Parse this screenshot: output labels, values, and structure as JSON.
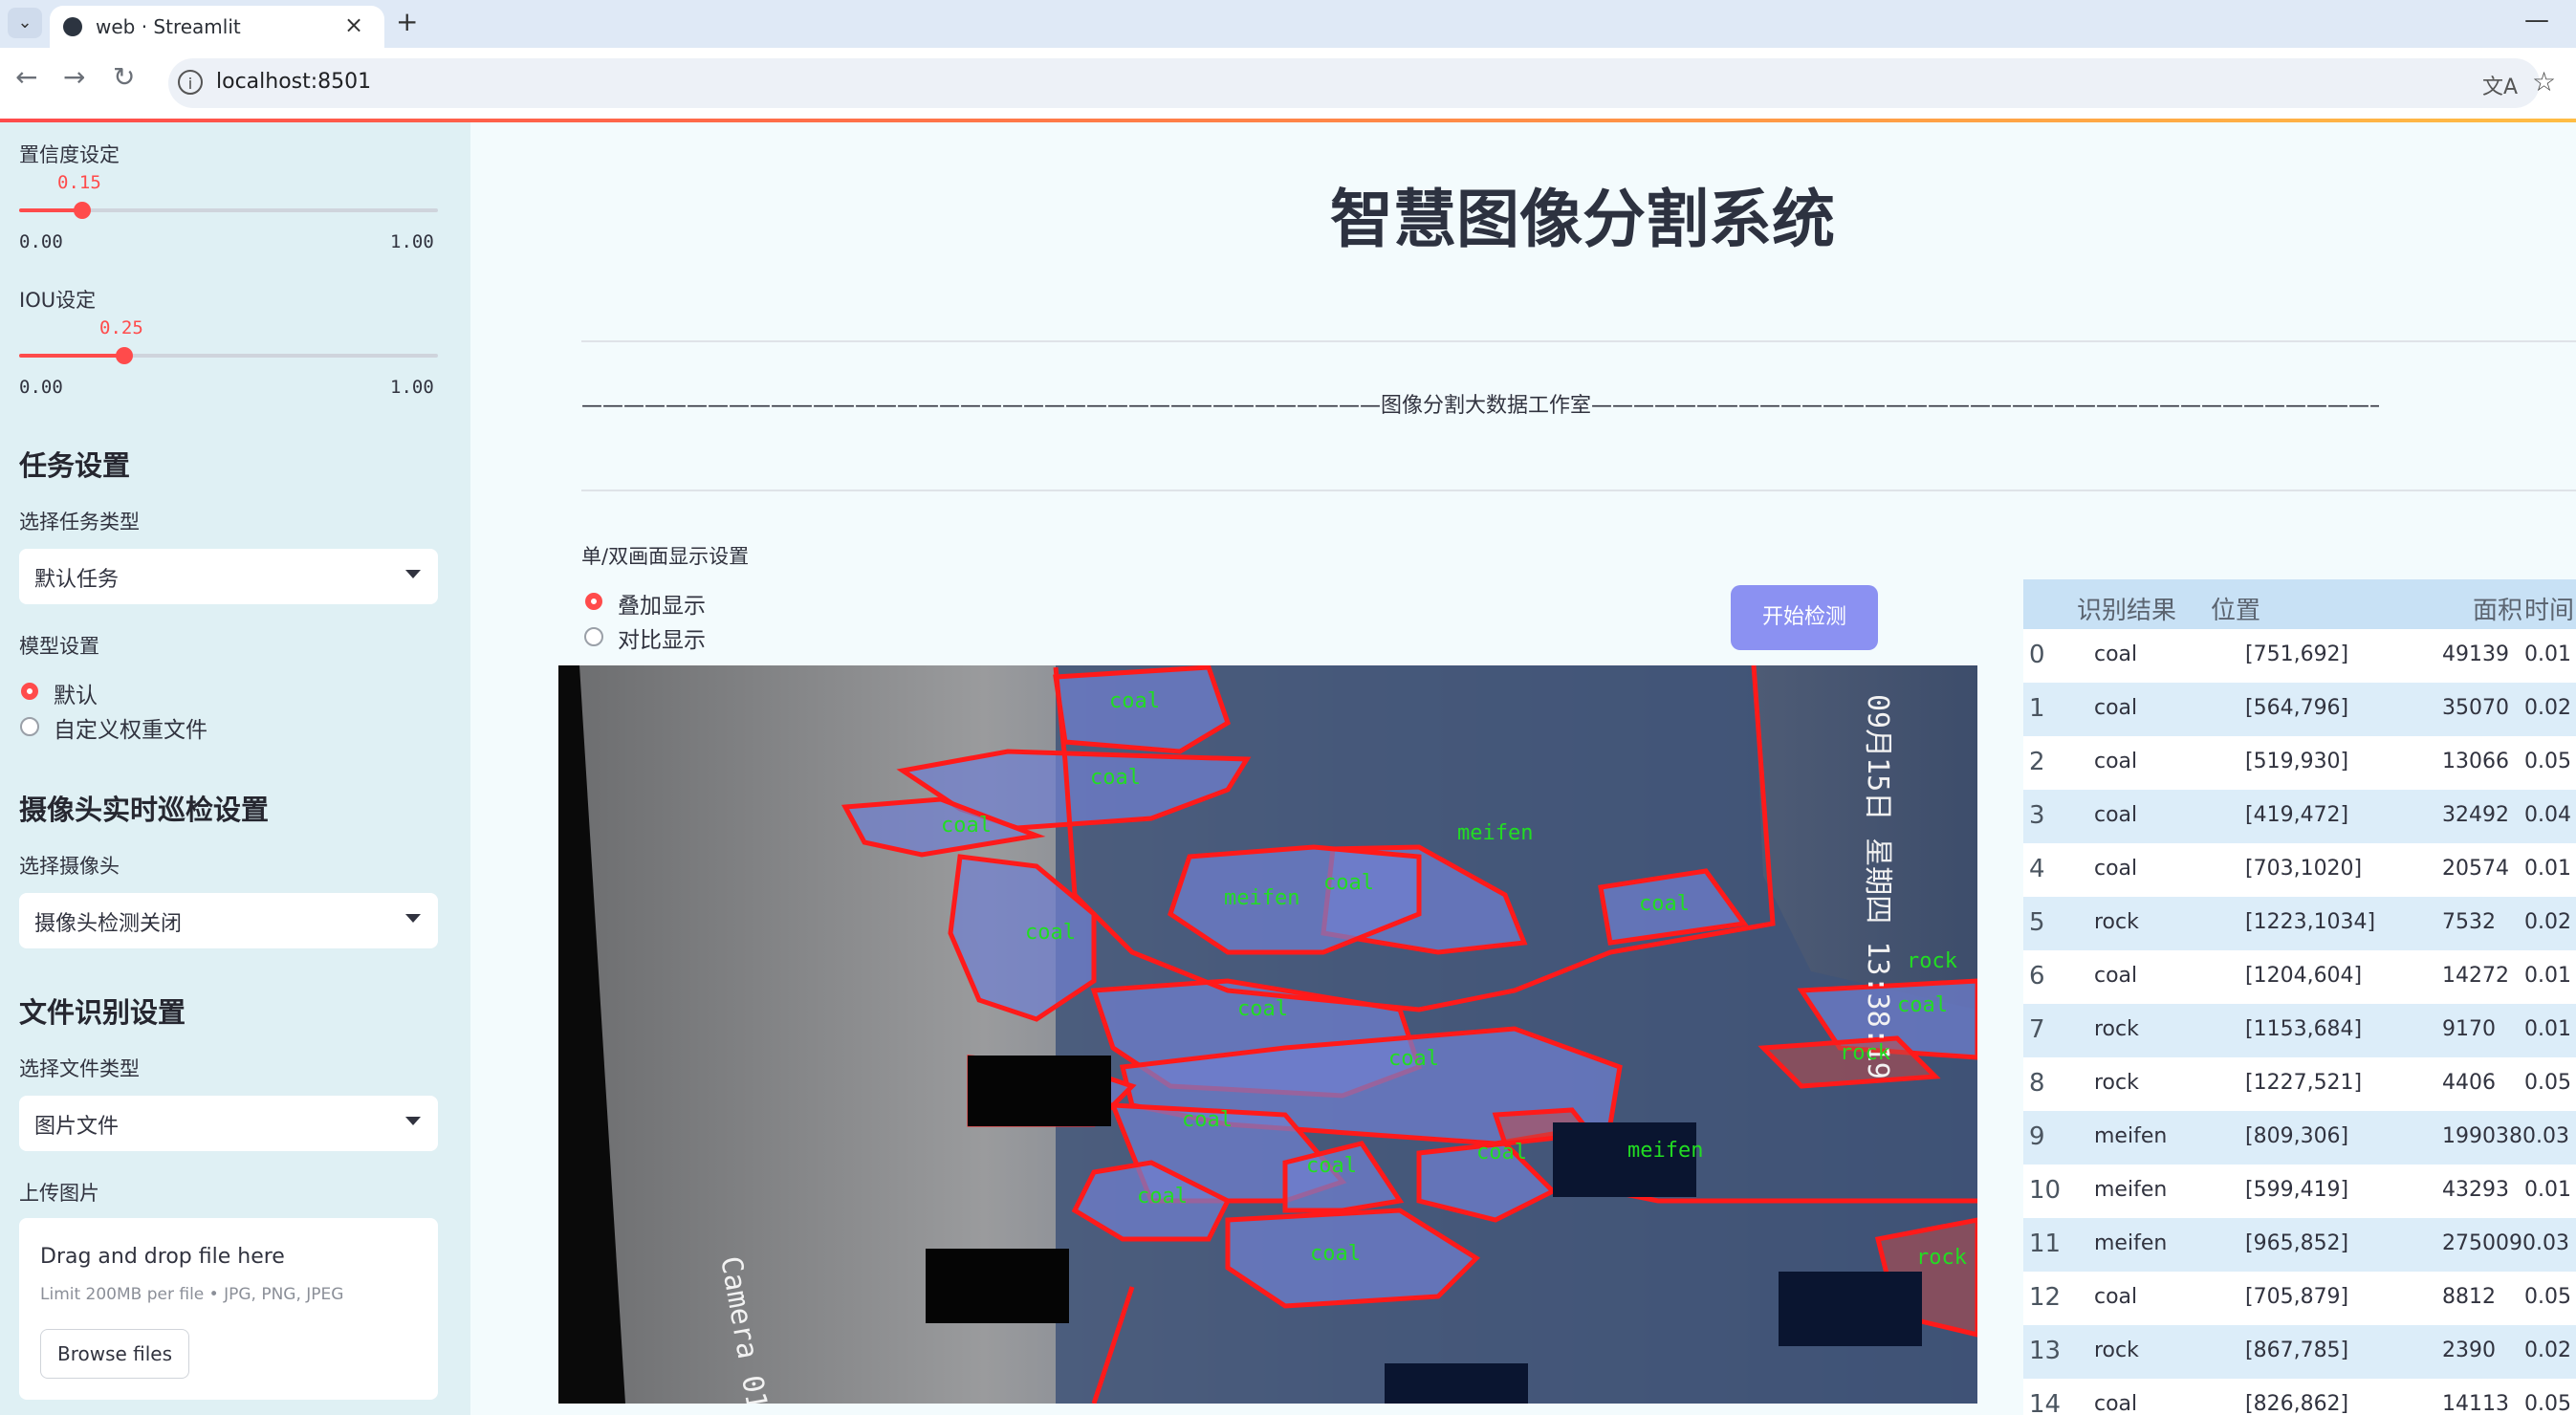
{
  "browser": {
    "tab_title": "web · Streamlit",
    "url": "localhost:8501",
    "tab_close": "×",
    "new_tab": "+",
    "minimize": "—"
  },
  "sidebar": {
    "confidence": {
      "label": "置信度设定",
      "value": "0.15",
      "value_fraction": 0.15,
      "min": "0.00",
      "max": "1.00"
    },
    "iou": {
      "label": "IOU设定",
      "value": "0.25",
      "value_fraction": 0.25,
      "min": "0.00",
      "max": "1.00"
    },
    "task_settings": {
      "heading": "任务设置",
      "select_label": "选择任务类型",
      "select_value": "默认任务"
    },
    "model_settings": {
      "label": "模型设置",
      "options": [
        "默认",
        "自定义权重文件"
      ],
      "selected": "默认"
    },
    "camera": {
      "heading": "摄像头实时巡检设置",
      "select_label": "选择摄像头",
      "select_value": "摄像头检测关闭"
    },
    "file": {
      "heading": "文件识别设置",
      "select_label": "选择文件类型",
      "select_value": "图片文件",
      "upload_label": "上传图片"
    },
    "uploader": {
      "title": "Drag and drop file here",
      "limit": "Limit 200MB per file • JPG, PNG, JPEG",
      "button": "Browse files"
    }
  },
  "main": {
    "title": "智慧图像分割系统",
    "divider_text": "——————————————————————————————————————图像分割大数据工作室——————————————————————————————————————",
    "display_mode": {
      "label": "单/双画面显示设置",
      "options": [
        "叠加显示",
        "对比显示"
      ],
      "selected": "叠加显示"
    },
    "start_button": "开始检测",
    "image_labels": {
      "camera": "Camera 01",
      "date": "09月15日 星期四 13:38:19",
      "masks": [
        "coal",
        "coal",
        "coal",
        "meifen",
        "coal",
        "meifen",
        "coal",
        "coal",
        "coal",
        "rock",
        "coal",
        "coal",
        "coal",
        "rock",
        "coal",
        "coal",
        "coal",
        "meifen",
        "coal",
        "rock"
      ]
    }
  },
  "table": {
    "headers": [
      "识别结果",
      "位置",
      "面积",
      "时间"
    ],
    "rows": [
      {
        "idx": "0",
        "result": "coal",
        "pos": "[751,692]",
        "area": "49139",
        "time": "0.01"
      },
      {
        "idx": "1",
        "result": "coal",
        "pos": "[564,796]",
        "area": "35070",
        "time": "0.02"
      },
      {
        "idx": "2",
        "result": "coal",
        "pos": "[519,930]",
        "area": "13066",
        "time": "0.05"
      },
      {
        "idx": "3",
        "result": "coal",
        "pos": "[419,472]",
        "area": "32492",
        "time": "0.04"
      },
      {
        "idx": "4",
        "result": "coal",
        "pos": "[703,1020]",
        "area": "20574",
        "time": "0.01"
      },
      {
        "idx": "5",
        "result": "rock",
        "pos": "[1223,1034]",
        "area": "7532",
        "time": "0.02"
      },
      {
        "idx": "6",
        "result": "coal",
        "pos": "[1204,604]",
        "area": "14272",
        "time": "0.01"
      },
      {
        "idx": "7",
        "result": "rock",
        "pos": "[1153,684]",
        "area": "9170",
        "time": "0.01"
      },
      {
        "idx": "8",
        "result": "rock",
        "pos": "[1227,521]",
        "area": "4406",
        "time": "0.05"
      },
      {
        "idx": "9",
        "result": "meifen",
        "pos": "[809,306]",
        "area": "1990380.03",
        "time": ""
      },
      {
        "idx": "10",
        "result": "meifen",
        "pos": "[599,419]",
        "area": "43293",
        "time": "0.01"
      },
      {
        "idx": "11",
        "result": "meifen",
        "pos": "[965,852]",
        "area": "2750090.03",
        "time": ""
      },
      {
        "idx": "12",
        "result": "coal",
        "pos": "[705,879]",
        "area": "8812",
        "time": "0.05"
      },
      {
        "idx": "13",
        "result": "rock",
        "pos": "[867,785]",
        "area": "2390",
        "time": "0.02"
      },
      {
        "idx": "14",
        "result": "coal",
        "pos": "[826,862]",
        "area": "14113",
        "time": "0.05"
      }
    ]
  },
  "colors": {
    "accent": "#ff4b4b",
    "button": "#8b91f2",
    "mask_outline": "#ff1a1a",
    "mask_fill": "#6f7fd8",
    "mask_label": "#22dd22"
  }
}
